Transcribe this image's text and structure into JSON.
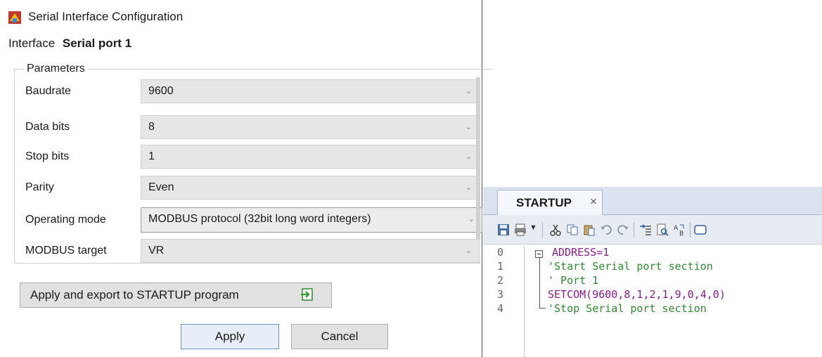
{
  "dialog": {
    "title": "Serial Interface Configuration",
    "interface_label": "Interface",
    "interface_value": "Serial port 1",
    "group_title": "Parameters",
    "params": [
      {
        "label": "Baudrate",
        "value": "9600"
      },
      {
        "label": "Data bits",
        "value": "8"
      },
      {
        "label": "Stop bits",
        "value": "1"
      },
      {
        "label": "Parity",
        "value": "Even"
      },
      {
        "label": "Operating mode",
        "value": "MODBUS protocol (32bit long word integers)"
      },
      {
        "label": "MODBUS target",
        "value": "VR"
      }
    ],
    "export_button": "Apply and export to STARTUP program",
    "apply_button": "Apply",
    "cancel_button": "Cancel"
  },
  "editor": {
    "tab_label": "STARTUP",
    "tab_close": "×",
    "lines": [
      {
        "num": "0",
        "text": "ADDRESS=1"
      },
      {
        "num": "1",
        "text": "'Start Serial port section"
      },
      {
        "num": "2",
        "text": "' Port 1"
      },
      {
        "num": "3",
        "text": "SETCOM(9600,8,1,2,1,9,0,4,0)"
      },
      {
        "num": "4",
        "text": "'Stop Serial port section"
      }
    ]
  },
  "colors": {
    "keyword": "#8b1a8b",
    "comment": "#2e8b2e",
    "tab_strip": "#d9e2ee"
  },
  "icons": [
    "app-icon",
    "chevron-down-icon",
    "export-arrow-icon",
    "save-icon",
    "print-icon",
    "cut-icon",
    "copy-icon",
    "paste-icon",
    "undo-icon",
    "redo-icon",
    "indent-icon",
    "find-icon",
    "replace-icon",
    "comment-box-icon"
  ]
}
